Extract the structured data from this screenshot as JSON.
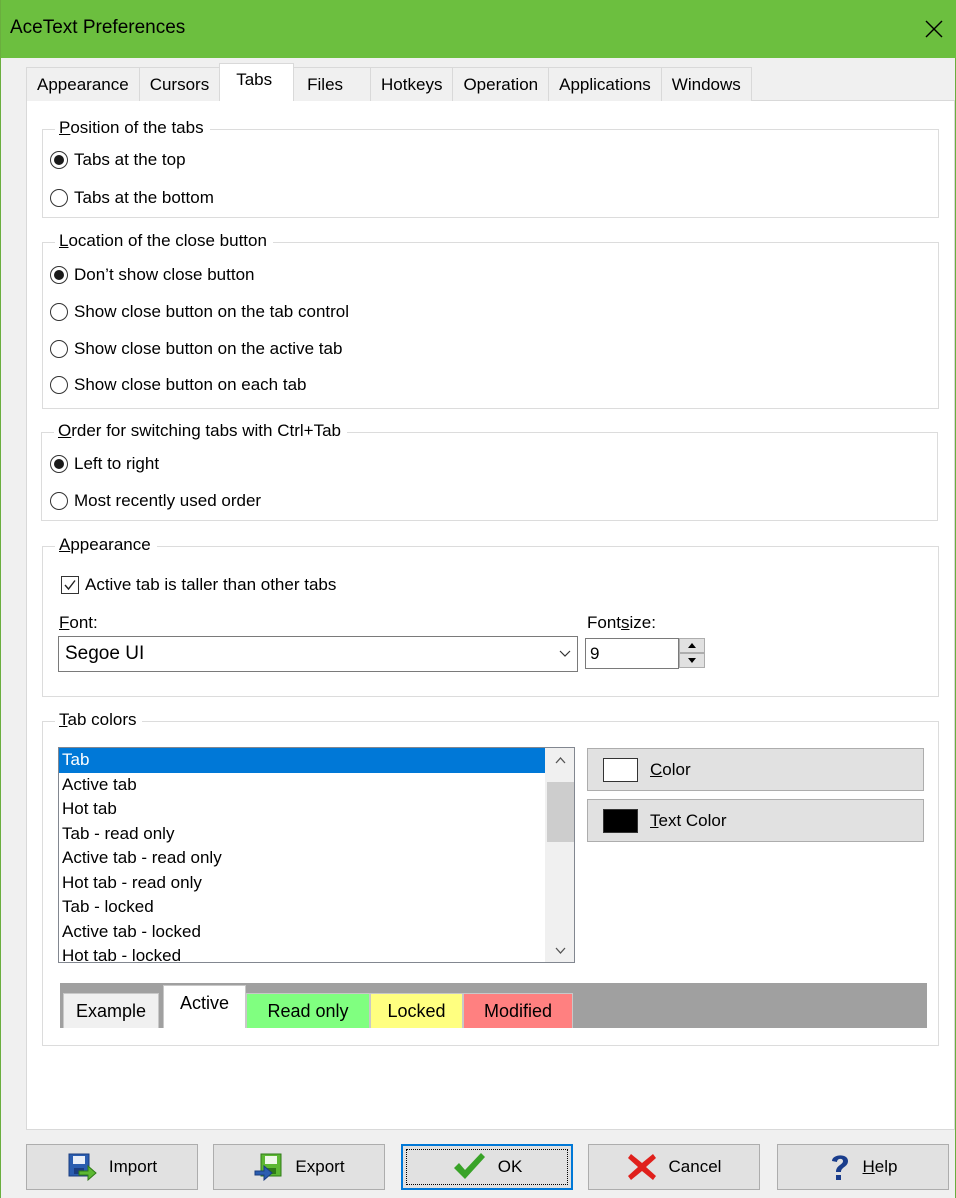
{
  "window": {
    "title": "AceText Preferences",
    "accent_color": "#6cbf3f"
  },
  "tabs": [
    {
      "label": "Appearance",
      "active": false
    },
    {
      "label": "Cursors",
      "active": false
    },
    {
      "label": "Tabs",
      "active": true
    },
    {
      "label": "Files",
      "active": false
    },
    {
      "label": "Hotkeys",
      "active": false
    },
    {
      "label": "Operation",
      "active": false
    },
    {
      "label": "Applications",
      "active": false
    },
    {
      "label": "Windows",
      "active": false
    }
  ],
  "position_group": {
    "legend": "Position of the tabs",
    "legend_hotkey": "P",
    "legend_rest": "osition of the tabs",
    "options": [
      {
        "label": "Tabs at the top",
        "checked": true
      },
      {
        "label": "Tabs at the bottom",
        "checked": false
      }
    ]
  },
  "close_group": {
    "legend": "Location of the close button",
    "legend_hotkey": "L",
    "legend_rest": "ocation of the close button",
    "options": [
      {
        "label": "Don’t show close button",
        "checked": true
      },
      {
        "label": "Show close button on the tab control",
        "checked": false
      },
      {
        "label": "Show close button on the active tab",
        "checked": false
      },
      {
        "label": "Show close button on each tab",
        "checked": false
      }
    ]
  },
  "order_group": {
    "legend": "Order for switching tabs with Ctrl+Tab",
    "legend_hotkey": "O",
    "legend_rest": "rder for switching tabs with Ctrl+Tab",
    "options": [
      {
        "label": "Left to right",
        "checked": true
      },
      {
        "label": "Most recently used order",
        "checked": false
      }
    ]
  },
  "appearance_group": {
    "legend": "Appearance",
    "legend_hotkey": "A",
    "legend_rest": "ppearance",
    "taller_checkbox": {
      "label": "Active tab is taller than other tabs",
      "checked": true
    },
    "font_label_hotkey": "F",
    "font_label_rest": "ont:",
    "font_value": "Segoe UI",
    "font_size_label_pre": "Font ",
    "font_size_label_hotkey": "s",
    "font_size_label_rest": "ize:",
    "font_size_value": "9"
  },
  "colors_group": {
    "legend_hotkey": "T",
    "legend_rest": "ab colors",
    "items": [
      "Tab",
      "Active tab",
      "Hot tab",
      "Tab - read only",
      "Active tab - read only",
      "Hot tab - read only",
      "Tab - locked",
      "Active tab - locked",
      "Hot tab - locked"
    ],
    "selected_index": 0,
    "color_button_hotkey": "C",
    "color_button_rest": "olor",
    "color_swatch": "#ffffff",
    "text_color_button_hotkey": "T",
    "text_color_button_rest": "ext Color",
    "text_color_swatch": "#000000",
    "preview_tabs": [
      {
        "label": "Example",
        "bg": "#f0f0f0"
      },
      {
        "label": "Active",
        "bg": "#ffffff"
      },
      {
        "label": "Read only",
        "bg": "#80ff80"
      },
      {
        "label": "Locked",
        "bg": "#ffff80"
      },
      {
        "label": "Modified",
        "bg": "#ff8080"
      }
    ]
  },
  "footer": {
    "import_label": "Import",
    "export_label": "Export",
    "ok_label": "OK",
    "cancel_label": "Cancel",
    "help_hotkey": "H",
    "help_rest": "elp"
  }
}
